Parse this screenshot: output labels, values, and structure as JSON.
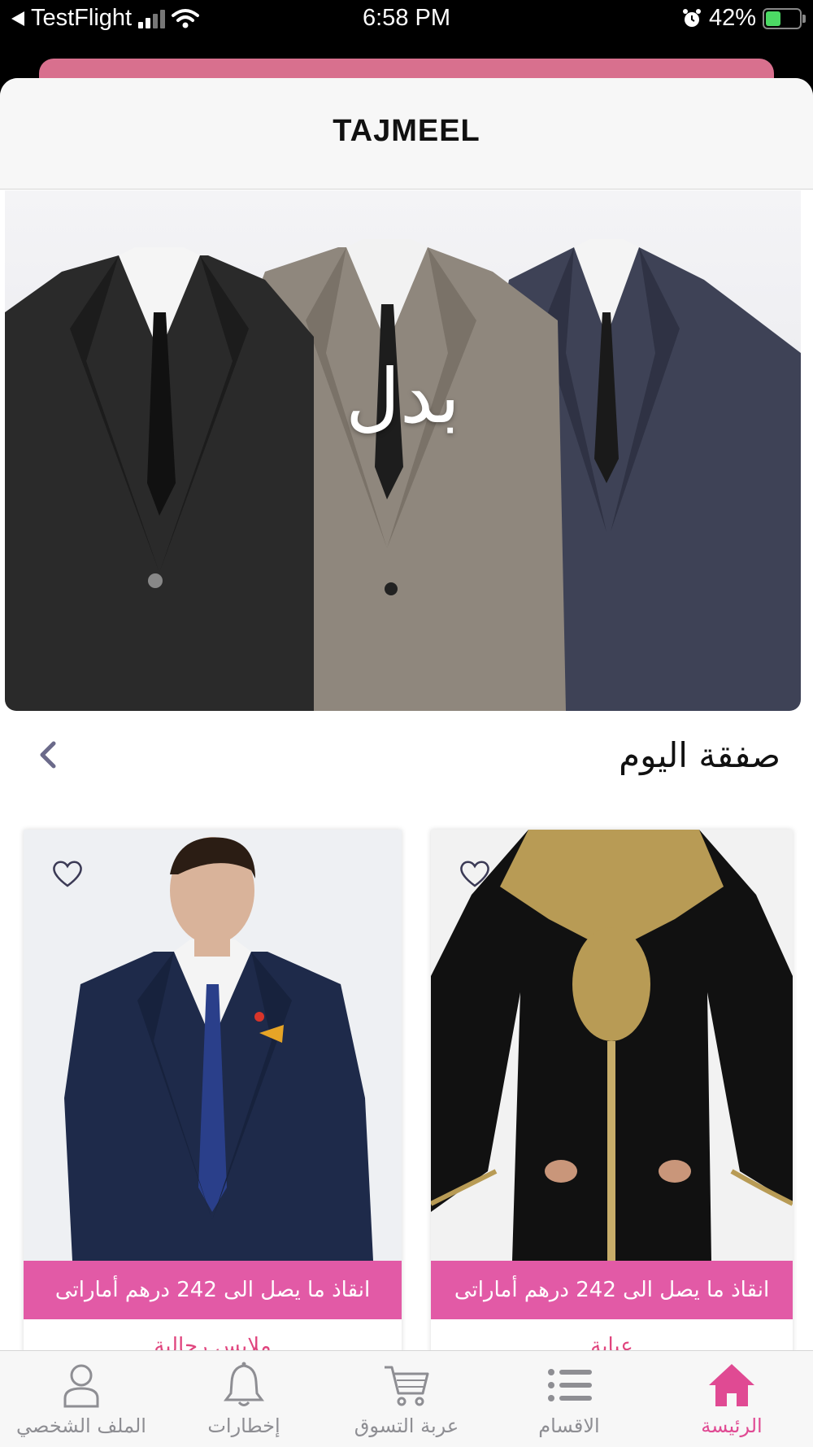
{
  "status_bar": {
    "carrier": "TestFlight",
    "time": "6:58 PM",
    "battery": "42%"
  },
  "header": {
    "title": "TAJMEEL"
  },
  "banner": {
    "title": "بدل"
  },
  "section": {
    "title": "صفقة اليوم"
  },
  "products": [
    {
      "deal_label": "انقاذ ما يصل الى 242 درهم أماراتى",
      "name_peek": "ملابس رجالية"
    },
    {
      "deal_label": "انقاذ ما يصل الى 242 درهم أماراتى",
      "name_peek": "عباية"
    }
  ],
  "tab_bar": {
    "items": [
      {
        "label": "الملف الشخصي",
        "icon": "person-icon"
      },
      {
        "label": "إخطارات",
        "icon": "bell-icon"
      },
      {
        "label": "عربة التسوق",
        "icon": "cart-icon"
      },
      {
        "label": "الاقسام",
        "icon": "list-icon"
      },
      {
        "label": "الرئيسة",
        "icon": "home-icon",
        "active": true
      }
    ]
  },
  "colors": {
    "accent": "#e04a93",
    "deal_strip": "#e25aa6",
    "header_bg": "#f7f7f7"
  }
}
